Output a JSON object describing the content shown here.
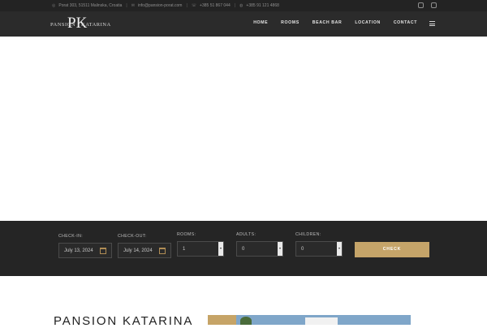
{
  "topbar": {
    "address": "Porat 303, 51511 Malinska, Croatia",
    "email": "info@pansion-porat.com",
    "phone1": "+385 51 867 044",
    "phone2": "+385 91 121 4868"
  },
  "header": {
    "logo_left": "PANSION",
    "logo_right": "KATARINA",
    "logo_monogram": "PK",
    "nav": [
      "HOME",
      "ROOMS",
      "BEACH BAR",
      "LOCATION",
      "CONTACT"
    ]
  },
  "booking": {
    "checkin_label": "CHECK-IN:",
    "checkin_value": "July 13, 2024",
    "checkout_label": "CHECK-OUT:",
    "checkout_value": "July 14, 2024",
    "rooms_label": "ROOMS:",
    "rooms_value": "1",
    "adults_label": "ADULTS:",
    "adults_value": "0",
    "children_label": "CHILDREN:",
    "children_value": "0",
    "check_button": "CHECK"
  },
  "content": {
    "title": "PANSION KATARINA"
  },
  "colors": {
    "accent": "#c5a469",
    "dark": "#252525",
    "header": "#2b2b2b"
  }
}
